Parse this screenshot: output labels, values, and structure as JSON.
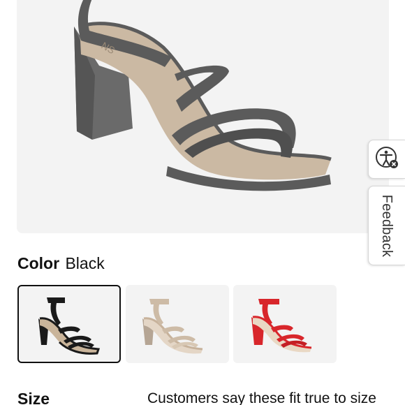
{
  "product": {
    "color_label": "Color",
    "color_value": "Black",
    "size_label": "Size",
    "fit_prefix": "Customers say these",
    "fit_link": "fit true to size"
  },
  "swatches": [
    {
      "color": "#1a1a1a",
      "selected": true
    },
    {
      "color": "#cdbba6",
      "selected": false
    },
    {
      "color": "#d8262b",
      "selected": false
    }
  ],
  "side_widgets": {
    "feedback_label": "Feedback",
    "accessibility_icon": "accessibility-icon"
  },
  "colors": {
    "hero_shoe": "#5b5b5b",
    "hero_background": "#f3f3f3",
    "selected_border": "#111111"
  }
}
